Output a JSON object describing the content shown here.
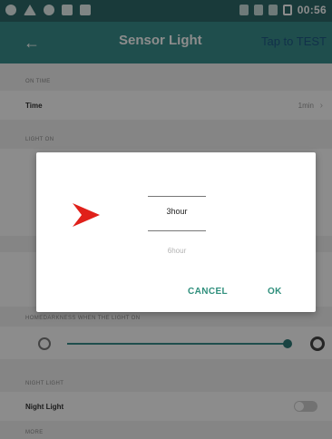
{
  "status_bar": {
    "time": "00:56"
  },
  "app_bar": {
    "back_glyph": "←",
    "title": "Sensor Light",
    "action": "Tap to TEST"
  },
  "sections": {
    "on_time": "ON TIME",
    "light_on": "LIGHT ON",
    "brightness": "HOMEDARKNESS WHEN THE LIGHT ON",
    "night_light": "NIGHT LIGHT",
    "more": "MORE"
  },
  "rows": {
    "time": {
      "label": "Time",
      "value": "1min"
    },
    "night_light": {
      "label": "Night Light"
    }
  },
  "dialog": {
    "selected": "3hour",
    "next": "6hour",
    "cancel": "CANCEL",
    "ok": "OK"
  },
  "colors": {
    "status_bar": "#2f6b6a",
    "app_bar": "#3a8f8c",
    "accent": "#2f8f7c",
    "pointer_arrow": "#e0201a"
  },
  "icons": [
    "back-arrow-icon",
    "chevron-right-icon",
    "brightness-low-icon",
    "brightness-high-icon",
    "pointer-arrow-icon"
  ]
}
